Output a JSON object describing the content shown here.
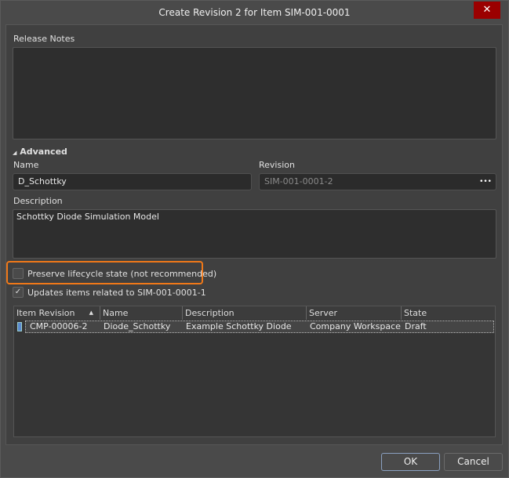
{
  "dialog": {
    "title": "Create Revision 2 for Item SIM-001-0001",
    "close": "✕"
  },
  "release_notes": {
    "label": "Release Notes",
    "value": ""
  },
  "advanced": {
    "label": "Advanced",
    "arrow": "◢"
  },
  "name": {
    "label": "Name",
    "value": "D_Schottky"
  },
  "revision": {
    "label": "Revision",
    "value": "SIM-001-0001-2",
    "more": "•••"
  },
  "description": {
    "label": "Description",
    "value": "Schottky Diode Simulation Model"
  },
  "preserve": {
    "label": "Preserve lifecycle state (not recommended)",
    "checked": false
  },
  "updates": {
    "label": "Updates items related to SIM-001-0001-1",
    "checked": true,
    "mark": "✓"
  },
  "table": {
    "headers": [
      "Item Revision",
      "Name",
      "Description",
      "Server",
      "State"
    ],
    "sort": "▲",
    "rows": [
      [
        "CMP-00006-2",
        "Diode_Schottky",
        "Example Schottky Diode",
        "Company Workspace",
        "Draft"
      ]
    ]
  },
  "buttons": {
    "ok": "OK",
    "cancel": "Cancel"
  },
  "colors": {
    "highlight": "#f07818",
    "close": "#9b0000"
  }
}
